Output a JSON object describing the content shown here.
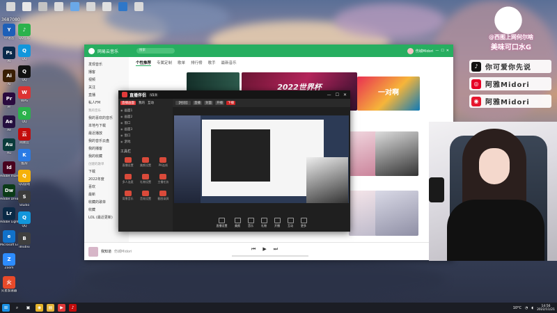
{
  "desktop": {
    "watermark": "3687080",
    "top_icons": [
      "",
      "",
      "",
      "",
      "",
      "",
      "",
      "",
      ""
    ],
    "left_icons": [
      {
        "label": "YY语音",
        "color": "#1d5fb8",
        "glyph": "Y"
      },
      {
        "label": "Ps",
        "color": "#0b2a4a",
        "glyph": "Ps"
      },
      {
        "label": "Ai",
        "color": "#3a1f05",
        "glyph": "Ai"
      },
      {
        "label": "Pr",
        "color": "#2a0a3e",
        "glyph": "Pr"
      },
      {
        "label": "Ae",
        "color": "#25103f",
        "glyph": "Ae"
      },
      {
        "label": "Au",
        "color": "#0b3b3b",
        "glyph": "Au"
      },
      {
        "label": "Adobe InDesign",
        "color": "#49021f",
        "glyph": "Id"
      },
      {
        "label": "Adobe Dreamwe...",
        "color": "#0b3b18",
        "glyph": "Dw"
      },
      {
        "label": "Adobe Lightroom",
        "color": "#0a2a46",
        "glyph": "Lr"
      },
      {
        "label": "Microsoft Edge",
        "color": "#1171c9",
        "glyph": "e"
      },
      {
        "label": "Zoom",
        "color": "#2d8cff",
        "glyph": "Z"
      },
      {
        "label": "火星加速器",
        "color": "#e84a2a",
        "glyph": "火"
      }
    ],
    "second_col_icons": [
      {
        "label": "QQ音乐",
        "color": "#2bb24c",
        "glyph": "♪"
      },
      {
        "label": "QQ",
        "color": "#1296db",
        "glyph": "Q"
      },
      {
        "label": "QQ",
        "color": "#111",
        "glyph": "Q"
      },
      {
        "label": "WPS",
        "color": "#d33",
        "glyph": "W"
      },
      {
        "label": "QQ",
        "color": "#2bb24c",
        "glyph": "Q"
      },
      {
        "label": "网易云",
        "color": "#c20c0c",
        "glyph": "云"
      },
      {
        "label": "酷狗",
        "color": "#2a7be4",
        "glyph": "K"
      },
      {
        "label": "QQ游戏",
        "color": "#f5b10a",
        "glyph": "Q"
      },
      {
        "label": "Studio",
        "color": "#3b3b3b",
        "glyph": "S"
      },
      {
        "label": "QQ",
        "color": "#1296db",
        "glyph": "Q"
      },
      {
        "label": "iBiubiu",
        "color": "#3f3f3f",
        "glyph": "B"
      }
    ]
  },
  "music_app": {
    "app_name": "网易云音乐",
    "search_placeholder": "搜索",
    "username": "伤城Midori",
    "sidebar": [
      "发现音乐",
      "播客",
      "视频",
      "关注",
      "直播",
      "私人FM",
      "我的音乐",
      "我的喜欢的音乐",
      "本地与下载",
      "最近播放",
      "我的音乐云盘",
      "我的播客",
      "我的收藏",
      "创建的歌单",
      "下载",
      "2022年度",
      "喜欢",
      "最新",
      "收藏的歌单",
      "收藏",
      "LOL (最近更新)"
    ],
    "sidebar_section_labels": [
      "我的音乐",
      "创建的歌单"
    ],
    "tabs": [
      "个性推荐",
      "专属定制",
      "歌单",
      "排行榜",
      "歌手",
      "最新音乐"
    ],
    "active_tab": "个性推荐",
    "banner_text": "2022世界杯",
    "banner_subtitle": "一对啊",
    "player": {
      "song": "我知道",
      "artist": "伤城Midori"
    }
  },
  "stream_app": {
    "title": "直播伴侣",
    "version": "V3.9",
    "left_tabs": [
      "直播画面",
      "我的",
      "互动"
    ],
    "scene_rows": [
      "画面1",
      "画面2",
      "窗口",
      "画面3",
      "窗口",
      "游戏"
    ],
    "tools_title": "工具栏",
    "tools": [
      "直播设置",
      "美颜设置",
      "PK连线",
      "多人连麦",
      "礼物设置",
      "主播任务",
      "背景音乐",
      "音效设置",
      "截图录屏"
    ],
    "top_chips": [
      "【经验】",
      "直播",
      "封面",
      "开播",
      "下播"
    ],
    "bottom_buttons": [
      "直播设置",
      "美颜",
      "音乐",
      "礼物",
      "开播",
      "互动",
      "更多"
    ]
  },
  "widgets": {
    "sign_line1": "@西图上网何尔啥",
    "sign_line2": "美味可口水G",
    "social": [
      {
        "platform": "tiktok-icon",
        "text": "你可爱你先说",
        "color": "#111"
      },
      {
        "platform": "netease-icon",
        "text": "阿雅Midori",
        "color": "#e60026"
      },
      {
        "platform": "weibo-icon",
        "text": "阿雅Midori",
        "color": "#e6162d"
      }
    ]
  },
  "taskbar": {
    "time": "14:56",
    "date": "2022/11/21",
    "temp": "10°C"
  }
}
